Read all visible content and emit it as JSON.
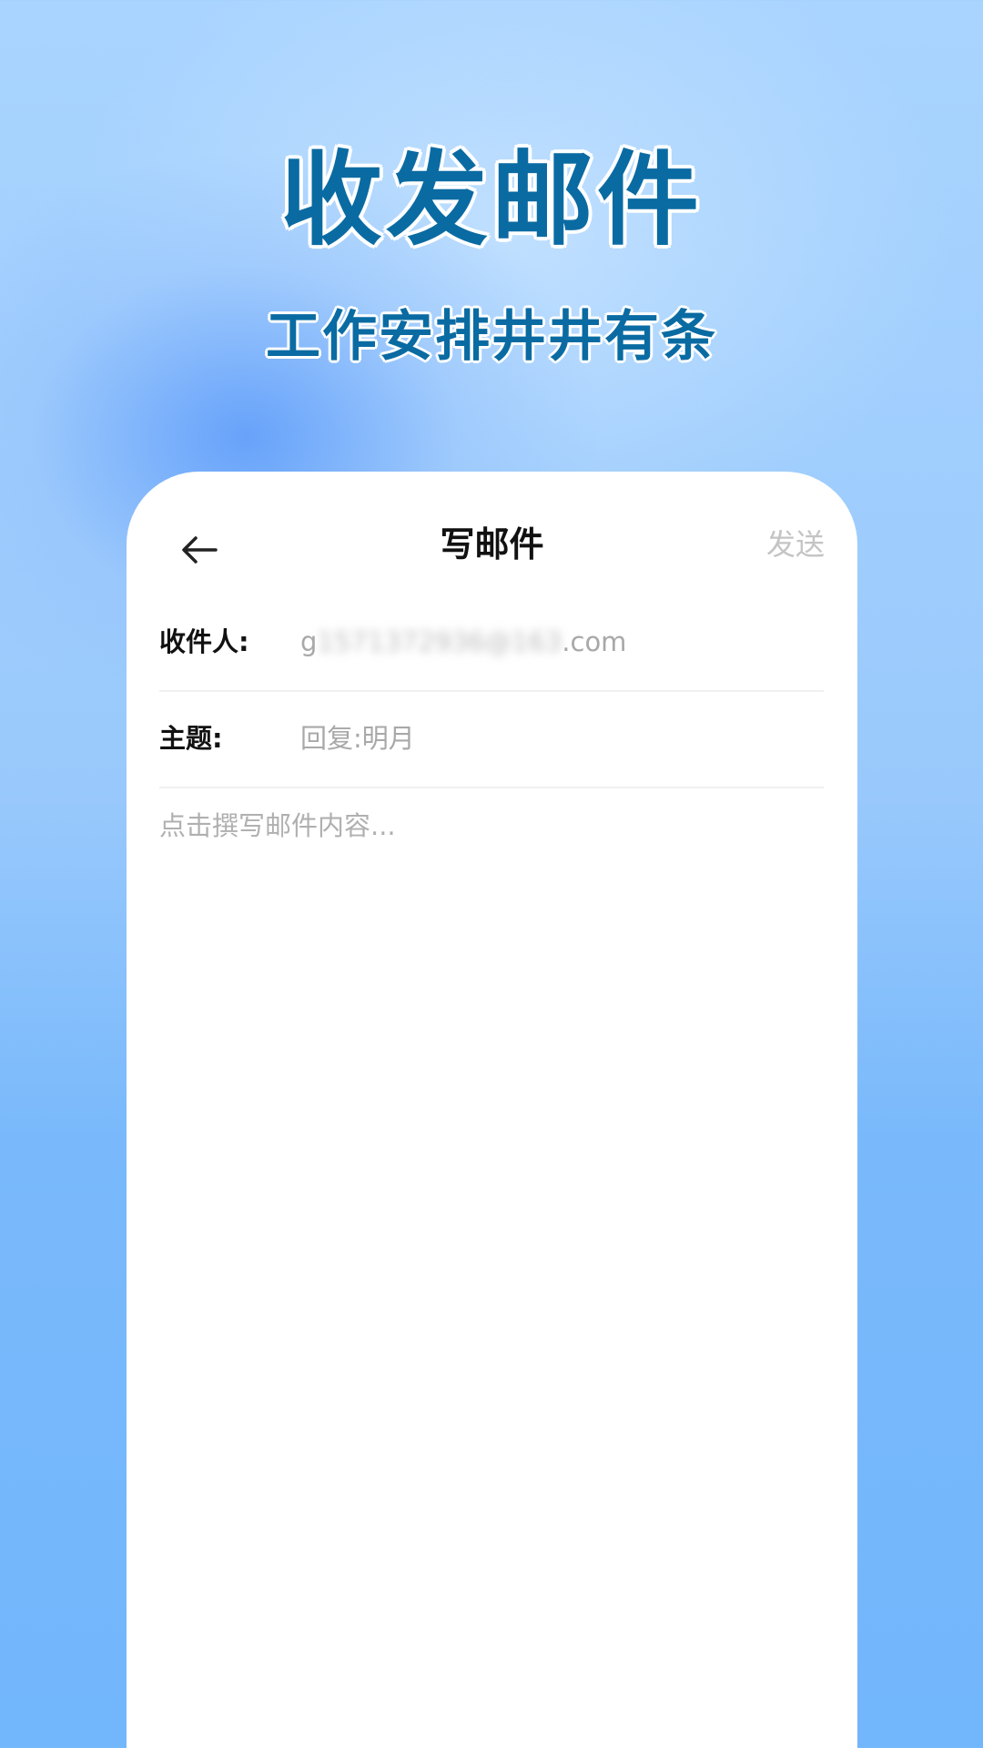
{
  "promo": {
    "title": "收发邮件",
    "subtitle": "工作安排井井有条"
  },
  "compose": {
    "nav_title": "写邮件",
    "send_label": "发送",
    "back_icon": "arrow-left-icon",
    "to_label": "收件人:",
    "to_prefix": "g",
    "to_masked": "1571372936@163",
    "to_suffix": ".com",
    "subject_label": "主题:",
    "subject_value": "回复:明月",
    "body_placeholder": "点击撰写邮件内容..."
  },
  "colors": {
    "promo_text": "#0a6ba3",
    "send_disabled": "#c4c4c4",
    "placeholder": "#a8a8a8"
  }
}
